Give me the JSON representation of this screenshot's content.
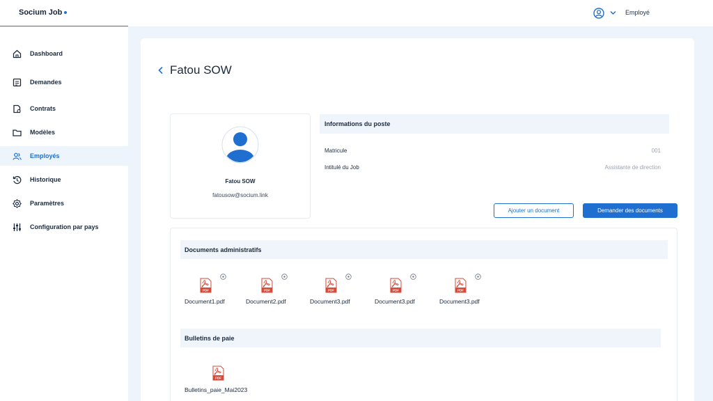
{
  "app": {
    "brand": "Socium Job"
  },
  "topbar": {
    "role_label": "Employé"
  },
  "sidebar": {
    "items": [
      {
        "label": "Dashboard",
        "icon": "home-icon"
      },
      {
        "label": "Demandes",
        "icon": "document-icon"
      },
      {
        "label": "Contrats",
        "icon": "contract-icon"
      },
      {
        "label": "Modèles",
        "icon": "folder-icon"
      },
      {
        "label": "Employés",
        "icon": "users-icon",
        "active": true
      },
      {
        "label": "Historique",
        "icon": "history-icon"
      },
      {
        "label": "Paramètres",
        "icon": "gear-icon"
      },
      {
        "label": "Configuration par pays",
        "icon": "sliders-icon"
      }
    ]
  },
  "page": {
    "title": "Fatou SOW"
  },
  "profile": {
    "name": "Fatou SOW",
    "email": "fatousow@socium.link"
  },
  "info": {
    "header": "Informations du poste",
    "rows": [
      {
        "label": "Matricule",
        "value": "001"
      },
      {
        "label": "Intitulé du Job",
        "value": "Assistante de direction"
      }
    ]
  },
  "actions": {
    "add_document": "Ajouter un document",
    "request_documents": "Demander des documents"
  },
  "documents": {
    "admin_header": "Documents administratifs",
    "admin_files": [
      "Document1.pdf",
      "Document2.pdf",
      "Document3.pdf",
      "Document3.pdf",
      "Document3.pdf"
    ],
    "payslips_header": "Bulletins de paie",
    "payslip_files": [
      "Bulletins_paie_Mai2023"
    ]
  },
  "colors": {
    "accent": "#1f6fd1",
    "pdf_red": "#d64a3a",
    "section_bg": "#f0f5fb"
  }
}
